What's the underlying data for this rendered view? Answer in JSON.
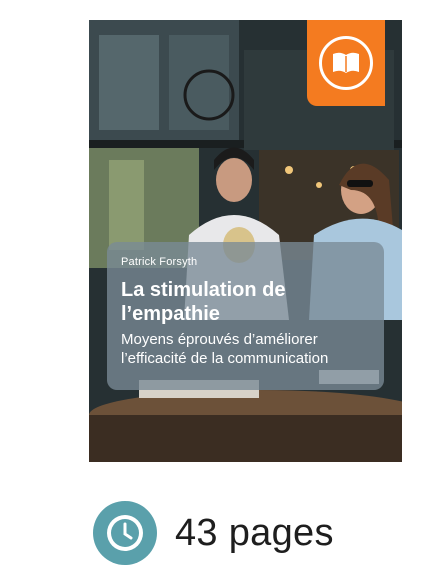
{
  "book": {
    "author": "Patrick Forsyth",
    "title_line1": "La stimulation de",
    "title_line2": "l’empathie",
    "subtitle_line1": "Moyens éprouvés d’améliorer",
    "subtitle_line2": "l’efficacité de la communication",
    "badge_icon": "book-icon",
    "badge_color": "#f47b20"
  },
  "meta": {
    "icon": "clock-icon",
    "icon_color": "#5aa0ab",
    "pages_label": "43 pages"
  }
}
